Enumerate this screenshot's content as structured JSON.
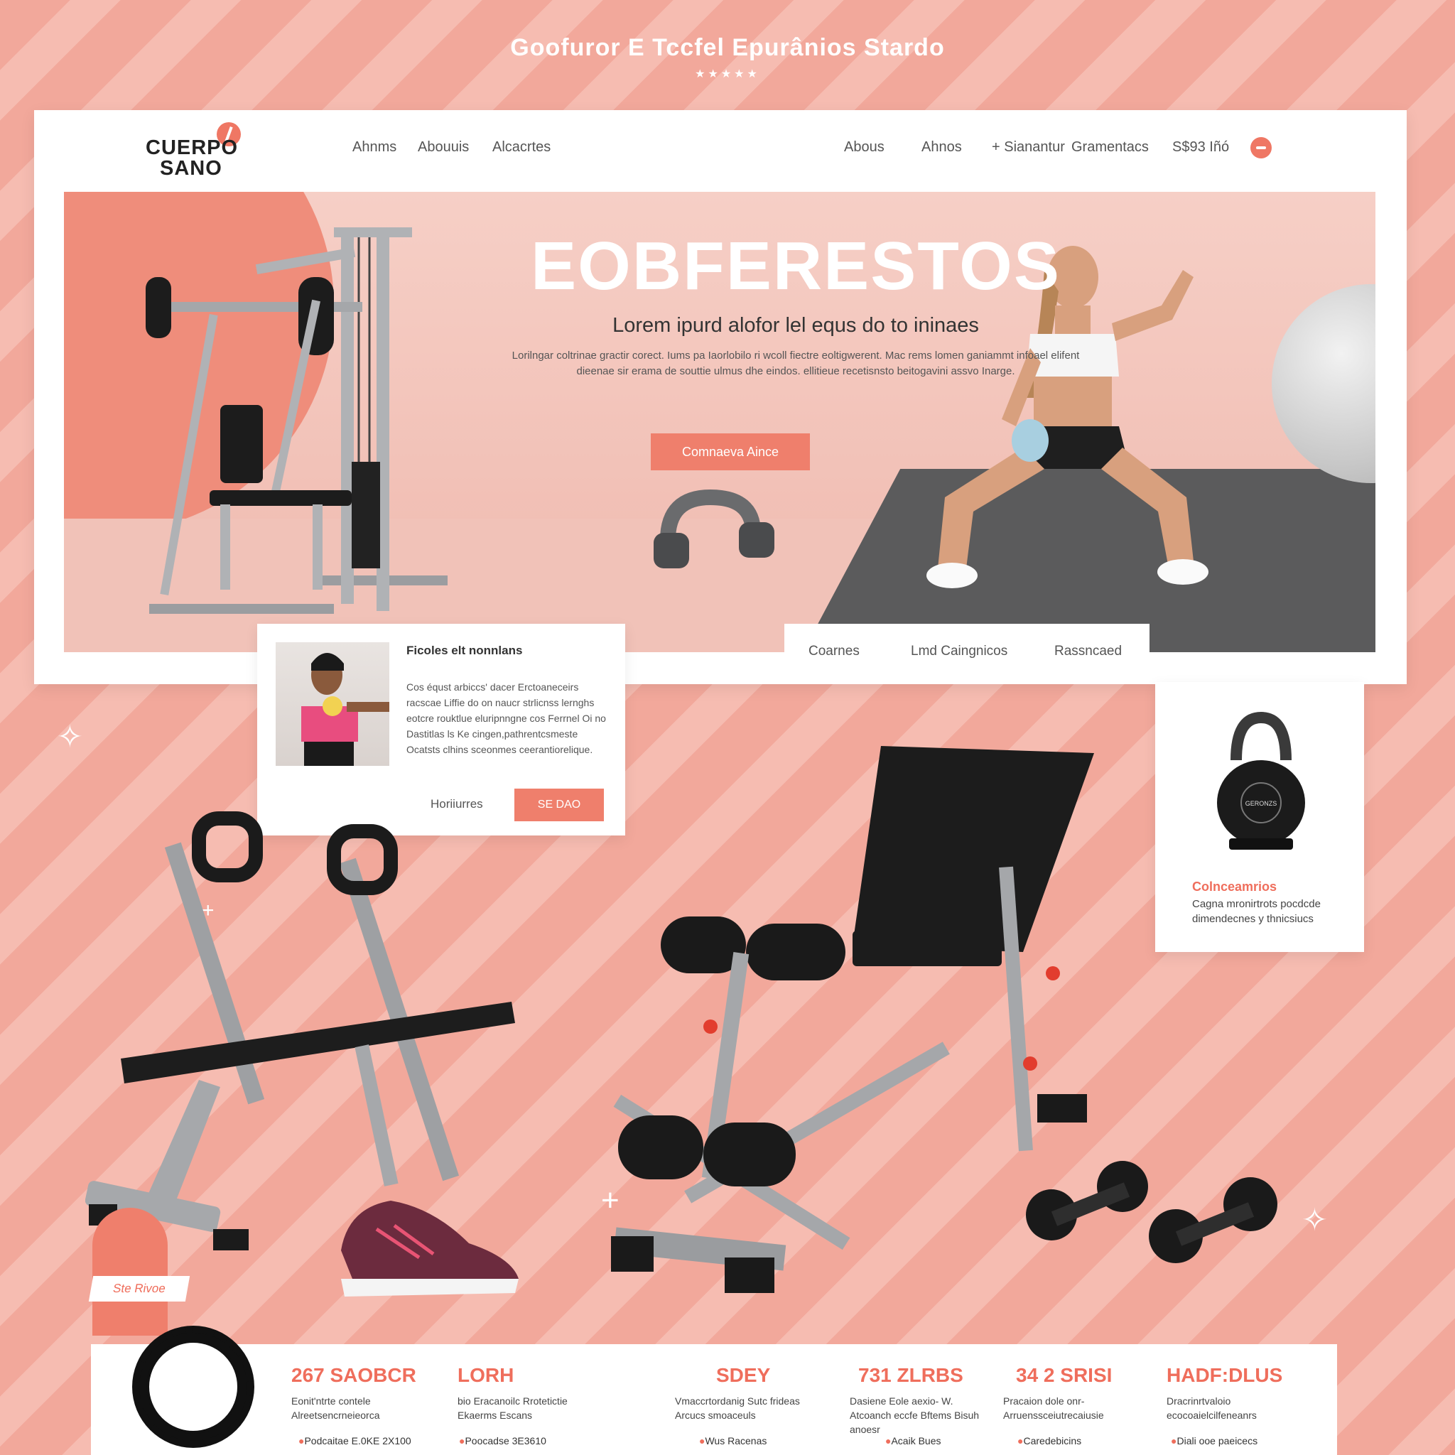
{
  "banner": {
    "title": "Goofuror E Tccfel Epurânios Stardo",
    "stars": "★★★★★"
  },
  "header": {
    "logo_line1": "CUERPO",
    "logo_line2": "SANO",
    "nav_left": [
      "Ahnms",
      "Abouuis",
      "Alcacrtes"
    ],
    "nav_right": [
      "Abous",
      "Ahnos",
      "+ Sianantur",
      "Gramentacs"
    ],
    "price": "S$93 Iñó"
  },
  "hero": {
    "title": "EOBFERESTOS",
    "subtitle": "Lorem ipurd alofor lel equs do to ininaes",
    "body": "Lorilngar coltrinae gractir corect. Iums pa Iaorlobilo ri wcoll fiectre eoltigwerent. Mac rems lomen ganiammt infoael elifent dieenae sir erama de souttie ulmus dhe eindos. ellitieue recetisnsto beitogavini assvo Inarge.",
    "cta": "Comnaeva Aince"
  },
  "info_card": {
    "title": "Ficoles elt nonnlans",
    "body": "Cos équst arbiccs' dacer Erctoaneceirs racscae Liffie do on naucr strlicnss lernghs eotcre rouktlue eluripnngne cos Ferrnel Oi no Dastitlas ls Ke cingen,pathrentcsmeste Ocatsts clhins sceonmes ceerantiorelique.",
    "link": "Horiiurres",
    "button": "SE DAO"
  },
  "tabs": [
    "Coarnes",
    "Lmd Caingnicos",
    "Rassncaed"
  ],
  "right_card": {
    "kettlebell_label": "GERONZS",
    "title": "Colnceamrios",
    "body": "Cagna mronirtrots pocdcde dimendecnes y thnicsiucs"
  },
  "bottom": {
    "badge": "Ste Rivoe",
    "stats": [
      {
        "title": "267 SAOBCR",
        "desc": "Eonit'ntrte contele Alreetsencrneieorca",
        "foot": "Podcaitae E.0KE 2X100"
      },
      {
        "title": "LORH",
        "desc": "bio Eracanoilc Rrotetictie Ekaerms Escans",
        "foot": "Poocadse 3E3610"
      },
      {
        "title": "SDEY",
        "desc": "Vmaccrtordanig Sutc frideas Arcucs smoaceuls",
        "foot": "Wus Racenas"
      },
      {
        "title": "731 ZLRBS",
        "desc": "Dasiene Eole aexio- W. Atcoanch eccfe Bftems Bisuh anoesr",
        "foot": "Acaik Bues"
      },
      {
        "title": "34 2 SRISI",
        "desc": "Pracaion dole onr- Arruenssceiutrecaiusie",
        "foot": "Caredebicins"
      },
      {
        "title": "HADF:DLUS",
        "desc": "Dracrinrtvaloio ecocoaielcilfeneanrs",
        "foot": "Diali ooe paeicecs"
      }
    ]
  },
  "colors": {
    "accent": "#ef7f6c",
    "stripe_dark": "#f2a89b",
    "stripe_light": "#f6bcb1"
  }
}
